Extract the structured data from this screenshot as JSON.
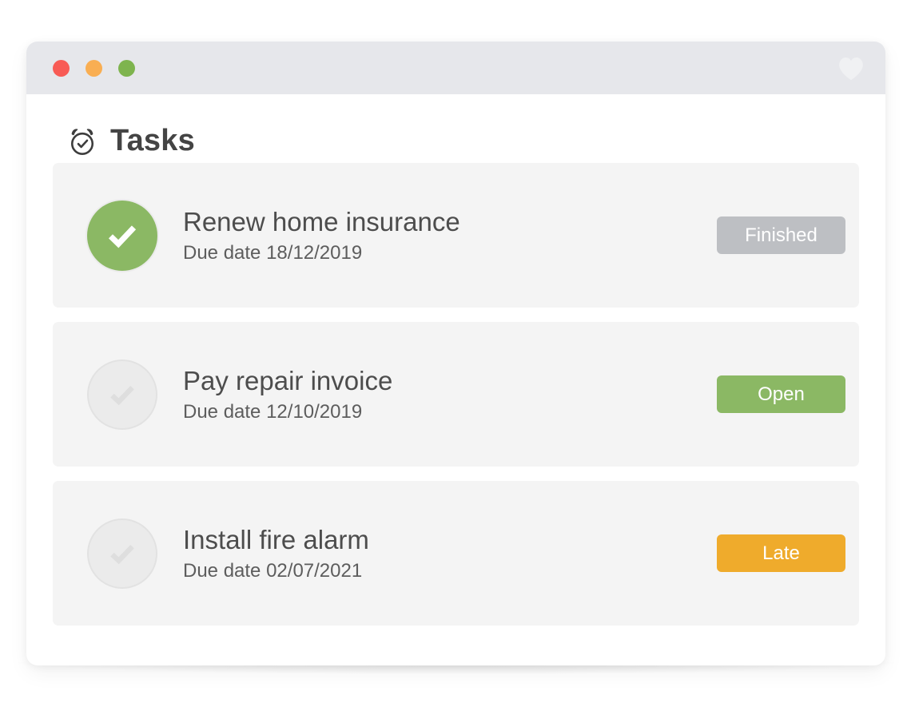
{
  "window": {
    "titlebar": {
      "controls": [
        {
          "name": "close",
          "color": "#f85b55",
          "label": "Close"
        },
        {
          "name": "minimize",
          "color": "#f9ae52",
          "label": "Minimize"
        },
        {
          "name": "maximize",
          "color": "#7eb44e",
          "label": "Maximize"
        }
      ],
      "favorite_icon": "heart-icon",
      "favorite_color": "#f1f2f4"
    }
  },
  "header": {
    "icon": "alarm-clock-check-icon",
    "title": "Tasks",
    "title_color": "#444444"
  },
  "tasks": [
    {
      "completed": true,
      "check_icon": "check-icon",
      "title": "Renew home insurance",
      "due": "Due date 18/12/2019",
      "status_label": "Finished",
      "status_color": "#bdbfc3",
      "status_class": "badge-finished",
      "circle_class": "done"
    },
    {
      "completed": false,
      "check_icon": "check-icon",
      "title": "Pay repair invoice",
      "due": "Due date 12/10/2019",
      "status_label": "Open",
      "status_color": "#8bb864",
      "status_class": "badge-open",
      "circle_class": "todo"
    },
    {
      "completed": false,
      "check_icon": "check-icon",
      "title": "Install fire alarm",
      "due": "Due date 02/07/2021",
      "status_label": "Late",
      "status_color": "#efab2c",
      "status_class": "badge-late",
      "circle_class": "todo"
    }
  ],
  "theme": {
    "card_background": "#f4f4f4",
    "titlebar_background": "#e6e7eb",
    "window_background": "#ffffff",
    "accent_green": "#8bb864",
    "accent_amber": "#efab2c",
    "accent_gray": "#bdbfc3"
  }
}
